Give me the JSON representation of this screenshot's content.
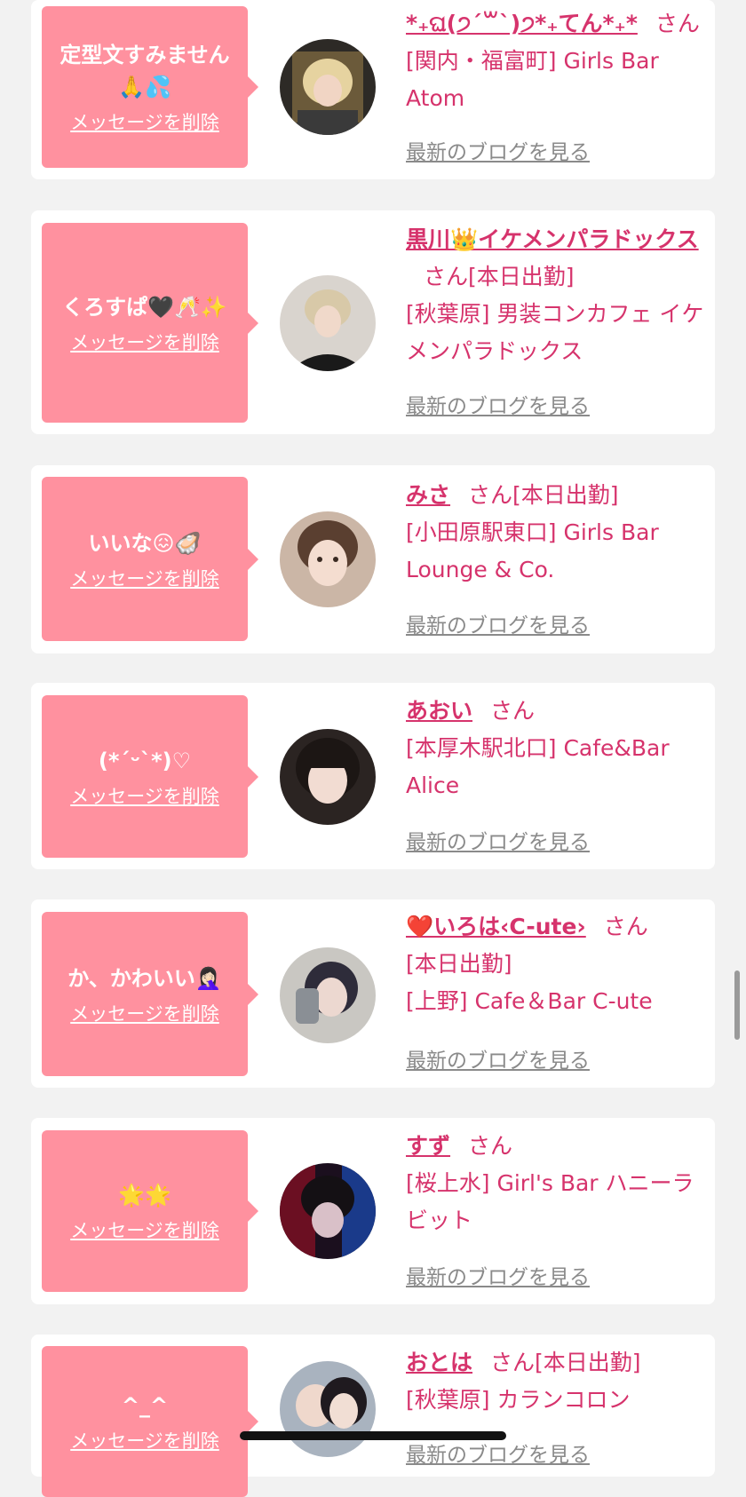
{
  "colors": {
    "background": "#f2f2f2",
    "bubble": "#ff919f",
    "accent_text": "#d6336c",
    "muted_link": "#8a8a8a"
  },
  "entries": [
    {
      "message": "定型文すみません🙏💦",
      "delete_label": "メッセージを削除",
      "name": "*₊ଘ(੭ˊ꒳ˋ)੭*₊てん*₊*",
      "honorific": "さん",
      "status": "",
      "shop": "[関内・福富町] Girls Bar Atom",
      "blog_link": "最新のブログを見る",
      "avatar_icon": "avatar-photo-blonde-girl"
    },
    {
      "message": "くろすぱ🖤🥂✨",
      "delete_label": "メッセージを削除",
      "name": "黒川👑イケメンパラドックス",
      "honorific": "さん",
      "status": "[本日出勤]",
      "shop": "[秋葉原] 男装コンカフェ イケメンパラドックス",
      "blog_link": "最新のブログを見る",
      "avatar_icon": "avatar-photo-ikemen"
    },
    {
      "message": "いいな😖🦪",
      "delete_label": "メッセージを削除",
      "name": "みさ",
      "honorific": "さん",
      "status": "[本日出勤]",
      "shop": "[小田原駅東口] Girls Bar Lounge & Co.",
      "blog_link": "最新のブログを見る",
      "avatar_icon": "avatar-photo-misa"
    },
    {
      "message": "(*ˊᵕˋ*)♡",
      "delete_label": "メッセージを削除",
      "name": "あおい",
      "honorific": "さん",
      "status": "",
      "shop": "[本厚木駅北口] Cafe&Bar Alice",
      "blog_link": "最新のブログを見る",
      "avatar_icon": "avatar-photo-aoi"
    },
    {
      "message": "か、かわいい🤦🏻‍♀️",
      "delete_label": "メッセージを削除",
      "name": "❤️いろは‹C-ute›",
      "honorific": "さん",
      "status": "[本日出勤]",
      "shop": "[上野] Cafe＆Bar C-ute",
      "blog_link": "最新のブログを見る",
      "avatar_icon": "avatar-photo-iroha"
    },
    {
      "message": "🌟🌟",
      "delete_label": "メッセージを削除",
      "name": "すず",
      "honorific": "さん",
      "status": "",
      "shop": "[桜上水] Girl's Bar ハニーラビット",
      "blog_link": "最新のブログを見る",
      "avatar_icon": "avatar-photo-suzu"
    },
    {
      "message": "^_^",
      "delete_label": "メッセージを削除",
      "name": "おとは",
      "honorific": "さん",
      "status": "[本日出勤]",
      "shop": "[秋葉原] カランコロン",
      "blog_link": "最新のブログを見る",
      "avatar_icon": "avatar-photo-otoha"
    }
  ]
}
